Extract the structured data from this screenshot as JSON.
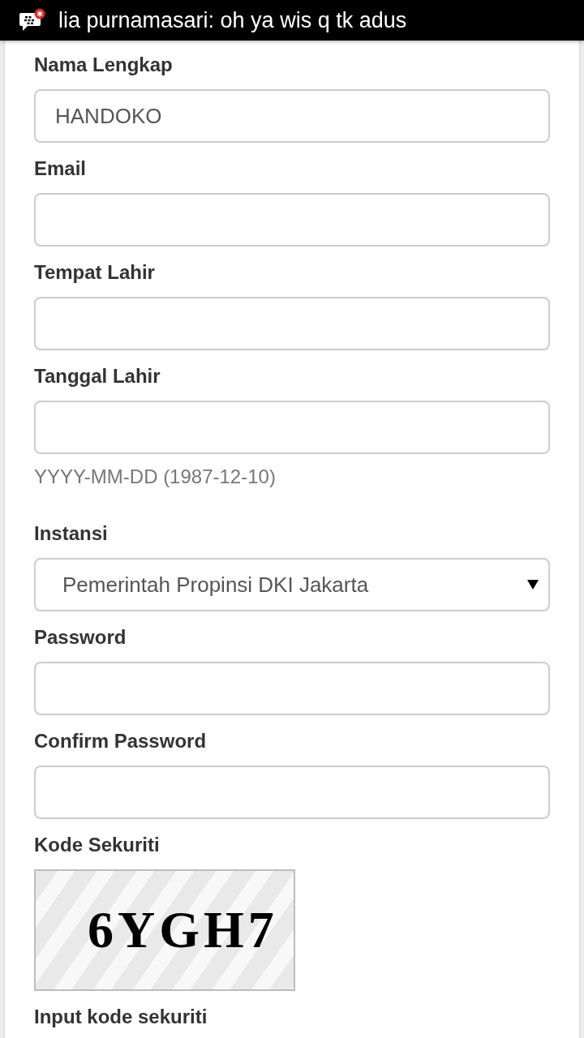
{
  "status_bar": {
    "notification": "lia purnamasari: oh ya wis q tk adus"
  },
  "form": {
    "fields": [
      {
        "kind": "text",
        "label": "Nama Lengkap",
        "value": "HANDOKO"
      },
      {
        "kind": "text",
        "label": "Email"
      },
      {
        "kind": "text",
        "label": "Tempat Lahir"
      },
      {
        "kind": "text",
        "label": "Tanggal Lahir",
        "help": "YYYY-MM-DD (1987-12-10)"
      },
      {
        "kind": "select",
        "label": "Instansi",
        "value": "Pemerintah Propinsi DKI Jakarta"
      },
      {
        "kind": "password",
        "label": "Password"
      },
      {
        "kind": "password",
        "label": "Confirm Password"
      },
      {
        "kind": "captcha",
        "label": "Kode Sekuriti",
        "code": "6YGH7"
      },
      {
        "kind": "label",
        "label": "Input kode sekuriti"
      }
    ]
  }
}
